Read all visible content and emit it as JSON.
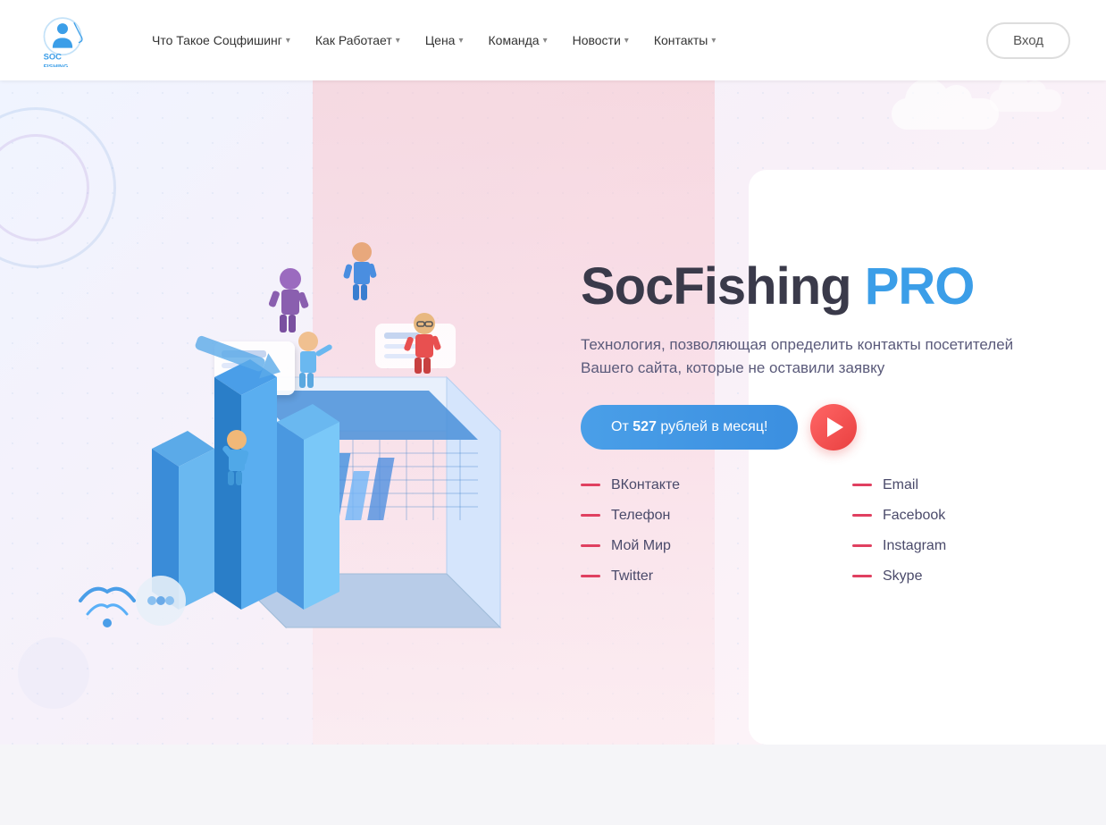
{
  "site": {
    "logo_text": "SOC FISHING"
  },
  "nav": {
    "items": [
      {
        "label": "Что Такое Соцфишинг",
        "has_dropdown": true
      },
      {
        "label": "Как Работает",
        "has_dropdown": true
      },
      {
        "label": "Цена",
        "has_dropdown": true
      },
      {
        "label": "Команда",
        "has_dropdown": true
      },
      {
        "label": "Новости",
        "has_dropdown": true
      },
      {
        "label": "Контакты",
        "has_dropdown": true
      }
    ],
    "login_label": "Вход"
  },
  "hero": {
    "title_part1": "SocFishing ",
    "title_pro": "PRO",
    "subtitle": "Технология, позволяющая определить контакты посетителей Вашего сайта, которые не оставили заявку",
    "cta_label_prefix": "От ",
    "cta_price": "527",
    "cta_label_suffix": " рублей в месяц!",
    "contacts": [
      {
        "label": "ВКонтакте"
      },
      {
        "label": "Email"
      },
      {
        "label": "Телефон"
      },
      {
        "label": "Facebook"
      },
      {
        "label": "Мой Мир"
      },
      {
        "label": "Instagram"
      },
      {
        "label": "Twitter"
      },
      {
        "label": "Skype"
      }
    ]
  }
}
